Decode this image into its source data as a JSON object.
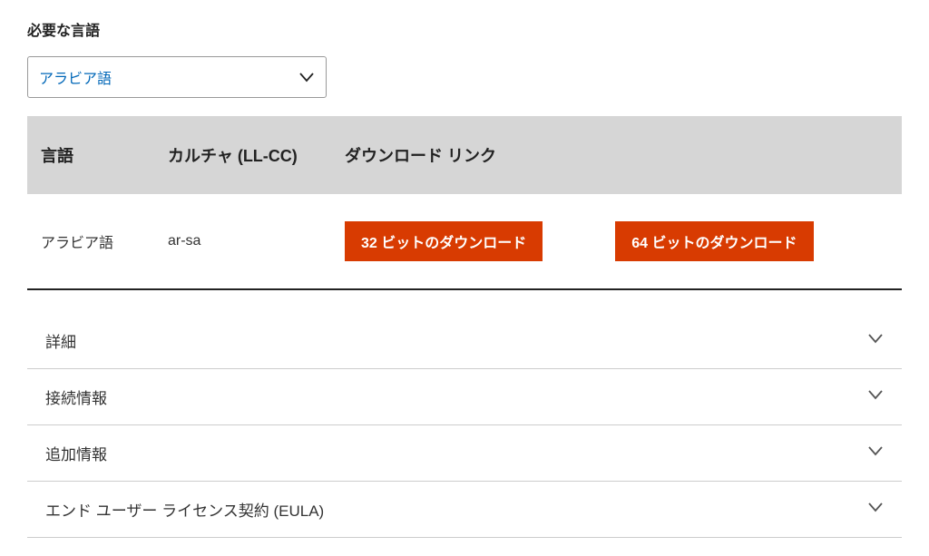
{
  "languageSelector": {
    "label": "必要な言語",
    "selected": "アラビア語"
  },
  "table": {
    "headers": {
      "language": "言語",
      "culture": "カルチャ (LL-CC)",
      "downloadLinks": "ダウンロード リンク"
    },
    "row": {
      "language": "アラビア語",
      "culture": "ar-sa",
      "download32": "32 ビットのダウンロード",
      "download64": "64 ビットのダウンロード"
    }
  },
  "accordion": {
    "items": [
      {
        "label": "詳細"
      },
      {
        "label": "接続情報"
      },
      {
        "label": "追加情報"
      },
      {
        "label": "エンド ユーザー ライセンス契約 (EULA)"
      }
    ]
  }
}
